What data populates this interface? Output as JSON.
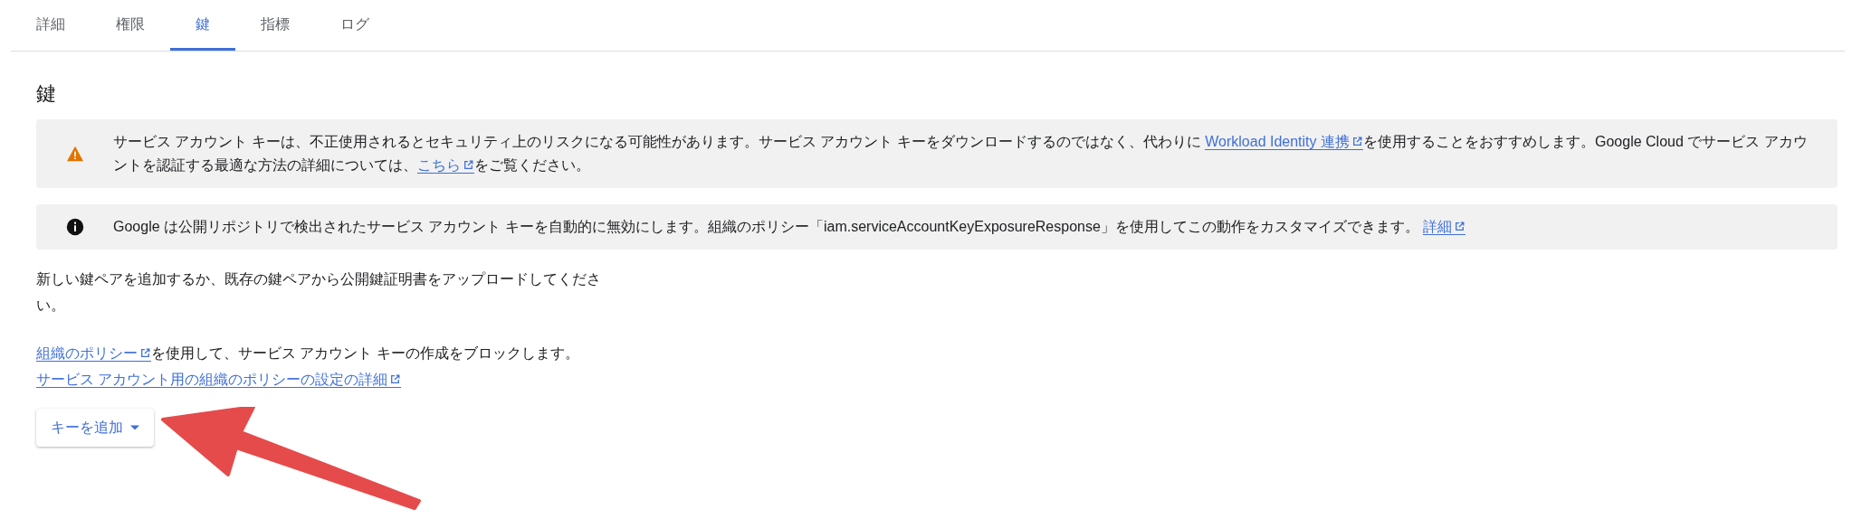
{
  "tabs": [
    {
      "label": "詳細",
      "selected": false
    },
    {
      "label": "権限",
      "selected": false
    },
    {
      "label": "鍵",
      "selected": true
    },
    {
      "label": "指標",
      "selected": false
    },
    {
      "label": "ログ",
      "selected": false
    }
  ],
  "heading": "鍵",
  "alerts": [
    {
      "kind": "warning",
      "parts": [
        {
          "kind": "text",
          "text": "サービス アカウント キーは、不正使用されるとセキュリティ上のリスクになる可能性があります。サービス アカウント キーをダウンロードするのではなく、代わりに "
        },
        {
          "kind": "link",
          "text": "Workload Identity 連携"
        },
        {
          "kind": "text",
          "text": "を使用することをおすすめします。Google Cloud でサービス アカウントを認証する最適な方法の詳細については、"
        },
        {
          "kind": "link",
          "text": "こちら"
        },
        {
          "kind": "text",
          "text": "をご覧ください。"
        }
      ]
    },
    {
      "kind": "info",
      "parts": [
        {
          "kind": "text",
          "text": "Google は公開リポジトリで検出されたサービス アカウント キーを自動的に無効にします。組織のポリシー「iam.serviceAccountKeyExposureResponse」を使用してこの動作をカスタマイズできます。 "
        },
        {
          "kind": "link",
          "text": "詳細"
        }
      ]
    }
  ],
  "description": "新しい鍵ペアを追加するか、既存の鍵ペアから公開鍵証明書をアップロードしてください。",
  "policy_lines": [
    [
      {
        "kind": "link",
        "text": "組織のポリシー"
      },
      {
        "kind": "text",
        "text": "を使用して、サービス アカウント キーの作成をブロックします。"
      }
    ],
    [
      {
        "kind": "link",
        "text": "サービス アカウント用の組織のポリシーの設定の詳細"
      }
    ]
  ],
  "add_key_button": {
    "label": "キーを追加"
  }
}
